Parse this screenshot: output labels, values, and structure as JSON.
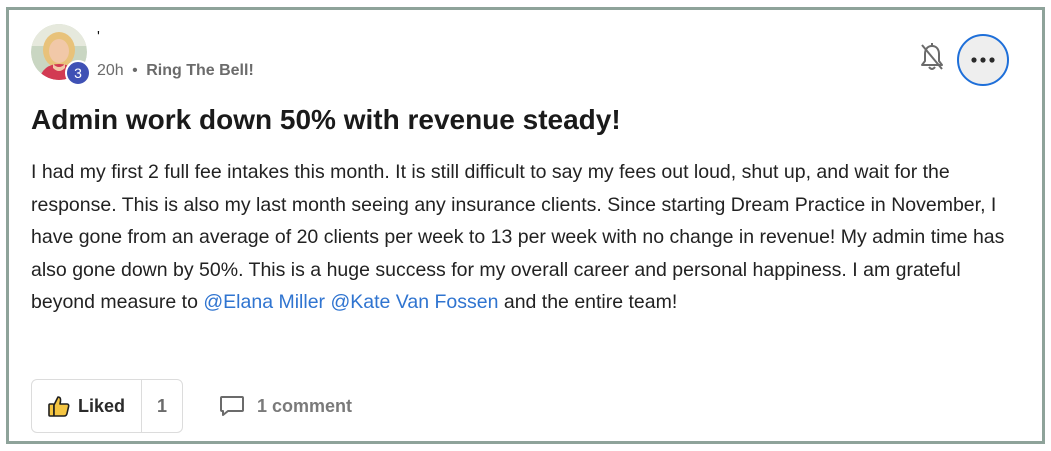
{
  "post": {
    "author": {
      "name": "'",
      "level": "3"
    },
    "meta": {
      "time": "20h",
      "separator": "•",
      "category": "Ring The Bell!"
    },
    "title": "Admin work down 50% with revenue steady!",
    "body": {
      "text": "I had my first 2 full fee intakes this month. It is still difficult to say my fees out loud, shut up, and wait for the response. This is also my last month seeing any insurance clients. Since starting Dream Practice in November, I have gone from an average of 20 clients per week to 13 per week with no change in revenue! My admin time has also gone down by 50%. This is a huge success for my overall career and personal happiness. I am grateful beyond measure to",
      "mention1": "@Elana Miller",
      "mention2": "@Kate Van Fossen",
      "tail": "and the entire team!"
    },
    "actions": {
      "like_label": "Liked",
      "like_count": "1",
      "comment_label": "1 comment"
    }
  },
  "icons": {
    "bell": "bell-off-icon",
    "more": "ellipsis-icon",
    "like": "thumbs-up-icon",
    "comment": "comment-bubble-icon"
  },
  "colors": {
    "frame_border": "#8ea39a",
    "mention": "#2f74d0",
    "badge": "#3f51b5",
    "focus_ring": "#1e6fd9"
  }
}
